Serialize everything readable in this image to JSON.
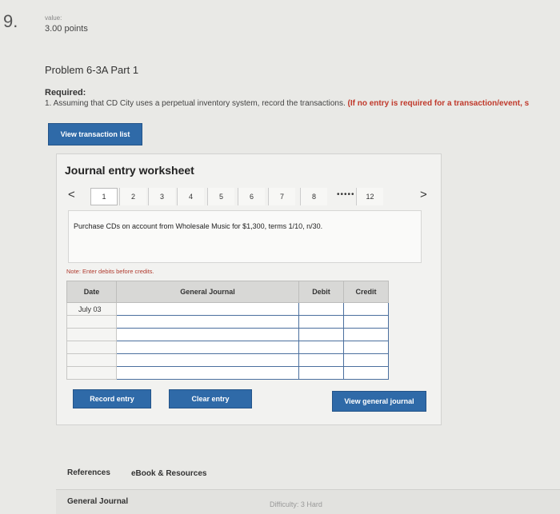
{
  "question": {
    "number": "9.",
    "value_label": "value:",
    "points": "3.00 points"
  },
  "problem": {
    "title": "Problem 6-3A Part 1",
    "required_label": "Required:",
    "requirement_text": "1. Assuming that CD City uses a perpetual inventory system, record the transactions.",
    "requirement_note": "(If no entry is required for a transaction/event, s"
  },
  "buttons": {
    "view_transaction_list": "View transaction list",
    "record_entry": "Record entry",
    "clear_entry": "Clear entry",
    "view_general_journal": "View general journal"
  },
  "worksheet": {
    "title": "Journal entry worksheet",
    "prev_symbol": "<",
    "next_symbol": ">",
    "pages": [
      "1",
      "2",
      "3",
      "4",
      "5",
      "6",
      "7",
      "8"
    ],
    "dots": "•••••",
    "last_page": "12",
    "active_page": "1",
    "description": "Purchase CDs on account from Wholesale Music for $1,300, terms 1/10, n/30.",
    "note": "Note: Enter debits before credits."
  },
  "journal": {
    "headers": {
      "date": "Date",
      "general_journal": "General Journal",
      "debit": "Debit",
      "credit": "Credit"
    },
    "first_date": "July 03"
  },
  "footer": {
    "references": "References",
    "ebook": "eBook & Resources",
    "general_journal_tab": "General Journal",
    "difficulty": "Difficulty: 3 Hard"
  }
}
